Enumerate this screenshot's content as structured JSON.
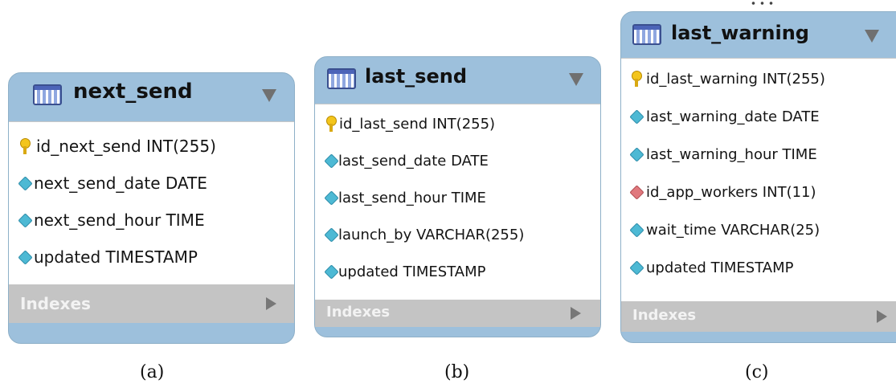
{
  "entities": [
    {
      "title": "next_send",
      "columns": [
        {
          "text": "id_next_send INT(255)",
          "kind": "primary-key"
        },
        {
          "text": "next_send_date DATE",
          "kind": "attribute"
        },
        {
          "text": "next_send_hour TIME",
          "kind": "attribute"
        },
        {
          "text": "updated TIMESTAMP",
          "kind": "attribute"
        }
      ],
      "indexes_label": "Indexes",
      "caption": "(a)"
    },
    {
      "title": "last_send",
      "columns": [
        {
          "text": "id_last_send INT(255)",
          "kind": "primary-key"
        },
        {
          "text": "last_send_date DATE",
          "kind": "attribute"
        },
        {
          "text": "last_send_hour TIME",
          "kind": "attribute"
        },
        {
          "text": "launch_by VARCHAR(255)",
          "kind": "attribute"
        },
        {
          "text": "updated TIMESTAMP",
          "kind": "attribute"
        }
      ],
      "indexes_label": "Indexes",
      "caption": "(b)"
    },
    {
      "title": "last_warning",
      "columns": [
        {
          "text": "id_last_warning INT(255)",
          "kind": "primary-key"
        },
        {
          "text": "last_warning_date DATE",
          "kind": "attribute"
        },
        {
          "text": "last_warning_hour TIME",
          "kind": "attribute"
        },
        {
          "text": "id_app_workers INT(11)",
          "kind": "foreign-key"
        },
        {
          "text": "wait_time VARCHAR(25)",
          "kind": "attribute"
        },
        {
          "text": "updated TIMESTAMP",
          "kind": "attribute"
        }
      ],
      "indexes_label": "Indexes",
      "caption": "(c)"
    }
  ],
  "icons": {
    "table": "table-icon",
    "primary_key": "key-icon",
    "attribute": "diamond-icon",
    "foreign_key": "foreign-key-diamond-icon",
    "collapse": "triangle-down-icon",
    "expand": "triangle-right-icon"
  },
  "colors": {
    "header": "#9dc0dc",
    "attribute_diamond": "#4db9d4",
    "foreign_key_diamond": "#e0787d",
    "key": "#f3c51c",
    "indexes_bar": "#c4c4c4"
  }
}
